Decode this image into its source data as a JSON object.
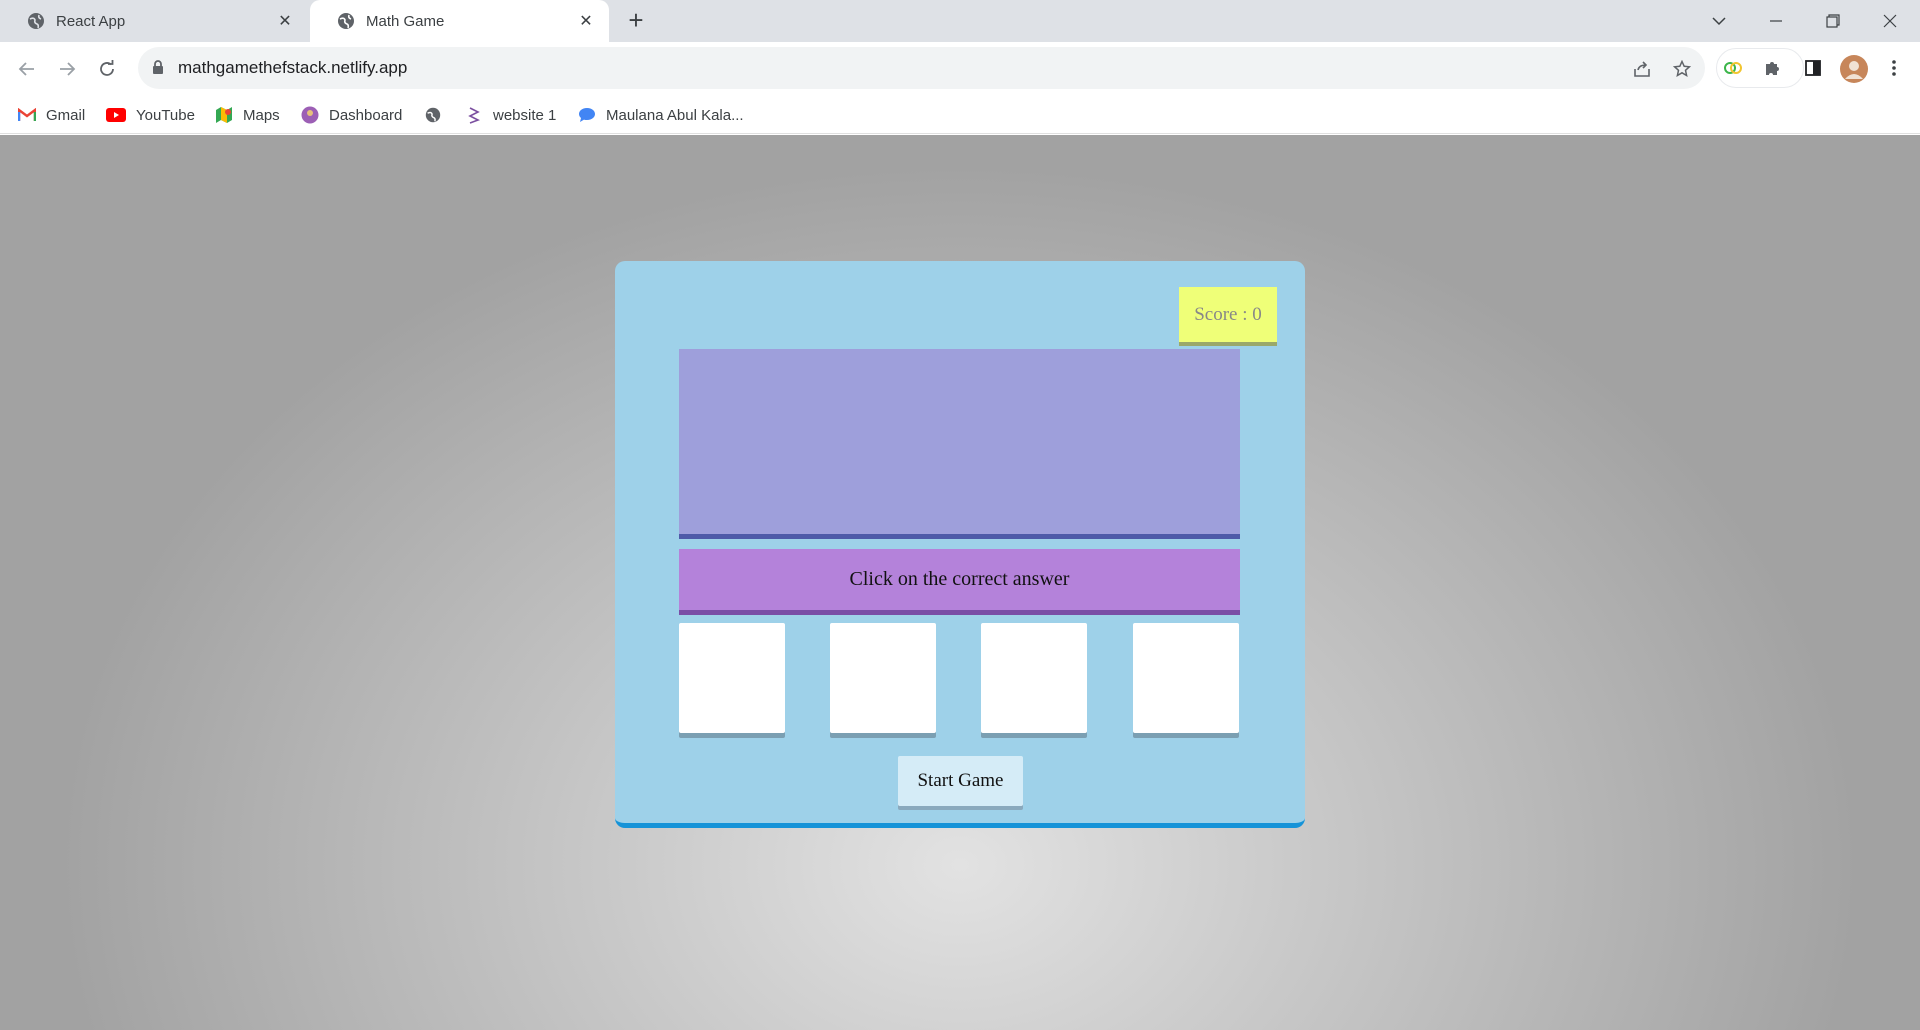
{
  "browser": {
    "tabs": [
      {
        "title": "React App",
        "active": false,
        "icon": "globe-icon"
      },
      {
        "title": "Math Game",
        "active": true,
        "icon": "globe-icon"
      }
    ],
    "new_tab_icon": "plus-icon",
    "url": "mathgamethefstack.netlify.app",
    "bookmarks": [
      {
        "label": "Gmail",
        "icon": "gmail-icon"
      },
      {
        "label": "YouTube",
        "icon": "youtube-icon"
      },
      {
        "label": "Maps",
        "icon": "maps-icon"
      },
      {
        "label": "Dashboard",
        "icon": "dashboard-icon"
      },
      {
        "label": "",
        "icon": "globe-icon"
      },
      {
        "label": "website 1",
        "icon": "website-icon"
      },
      {
        "label": "Maulana Abul Kala...",
        "icon": "chat-icon"
      }
    ]
  },
  "game": {
    "score_label": "Score : 0",
    "question_text": "",
    "instruction": "Click on the correct answer",
    "choices": [
      "",
      "",
      "",
      ""
    ],
    "start_button": "Start Game"
  },
  "colors": {
    "game_bg": "#9ed1e9",
    "game_border": "#1593d8",
    "score_bg": "#efff78",
    "question_bg": "#9e9fdb",
    "instruction_bg": "#b482da",
    "choice_bg": "#ffffff",
    "start_bg": "#d5ecf7"
  }
}
